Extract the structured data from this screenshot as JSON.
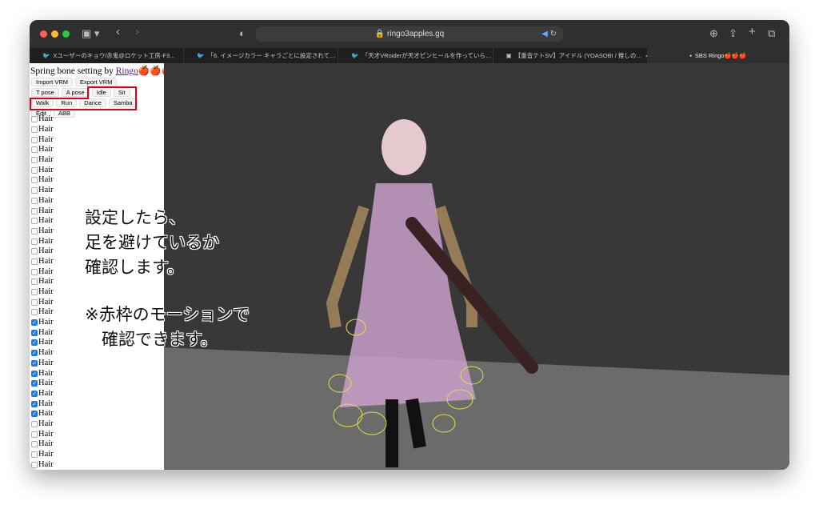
{
  "browser": {
    "url": "ringo3apples.gq",
    "tabs": [
      {
        "label": "Xユーザーのキョウ/赤鬼@ロケット工房-F3...",
        "icon": "twitter-icon"
      },
      {
        "label": "「6. イメージカラー キャラごとに設定されて…",
        "icon": "twitter-icon"
      },
      {
        "label": "「天才VRoiderが天才ピンヒールを作っていら…",
        "icon": "twitter-icon"
      },
      {
        "label": "【重音テトSV】アイドル (YOASOBI / 推しの…",
        "icon": "youtube-icon"
      },
      {
        "label": "SBS Ringo🍎🍎🍎",
        "icon": "site-icon",
        "active": true
      }
    ]
  },
  "panel": {
    "title": "Spring bone setting by ",
    "author": "Ringo",
    "apples": "🍎🍎🍎",
    "buttons_row1": [
      "Import VRM",
      "Export VRM"
    ],
    "buttons_row2": [
      "T pose",
      "A pose",
      "Idle",
      "Sit"
    ],
    "buttons_row3": [
      "Walk",
      "Run",
      "Dance",
      "Samba"
    ],
    "buttons_row4": [
      "Edit",
      "ABB"
    ],
    "bone_label": "Hair",
    "bones_checked": [
      false,
      false,
      false,
      false,
      false,
      false,
      false,
      false,
      false,
      false,
      false,
      false,
      false,
      false,
      false,
      false,
      false,
      false,
      false,
      false,
      true,
      true,
      true,
      true,
      true,
      true,
      true,
      true,
      true,
      true,
      false,
      false,
      false,
      false,
      false
    ]
  },
  "annotation": {
    "line1": "設定したら、\n足を避けているか\n確認します。",
    "line2": "※赤枠のモーションで\n　確認できます。",
    "highlight_color": "#e0001a"
  }
}
